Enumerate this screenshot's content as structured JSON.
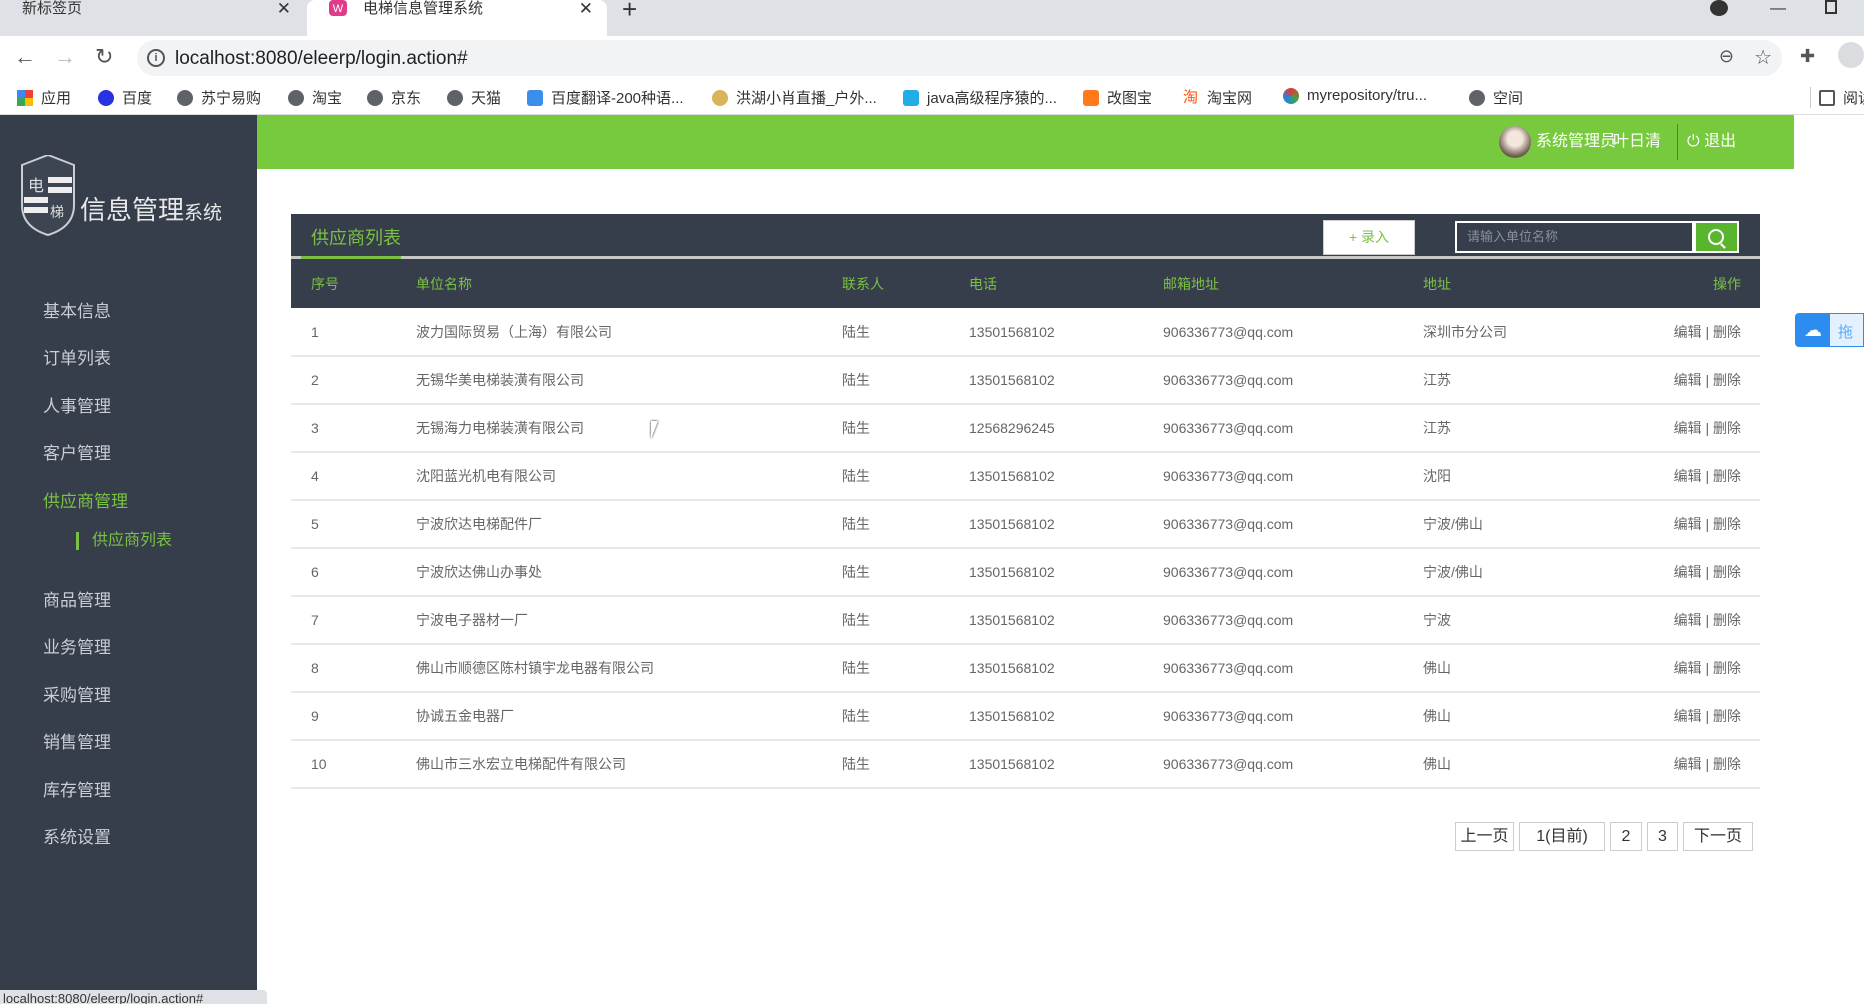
{
  "browser": {
    "tabs": [
      {
        "title": "新标签页"
      },
      {
        "title": "电梯信息管理系统"
      }
    ],
    "url": "localhost:8080/eleerp/login.action#",
    "status_url": "localhost:8080/eleerp/login.action#",
    "bookmarks": [
      "应用",
      "百度",
      "苏宁易购",
      "淘宝",
      "京东",
      "天猫",
      "百度翻译-200种语...",
      "洪湖小肖直播_户外...",
      "java高级程序猿的...",
      "改图宝",
      "淘宝网",
      "myrepository/tru...",
      "空间",
      "阅读"
    ]
  },
  "logo": {
    "text": "信息管理系统",
    "badge": "电梯"
  },
  "sidebar": {
    "items": [
      "基本信息",
      "订单列表",
      "人事管理",
      "客户管理",
      "供应商管理",
      "商品管理",
      "业务管理",
      "采购管理",
      "销售管理",
      "库存管理",
      "系统设置"
    ],
    "active": "供应商管理",
    "subitem": "供应商列表"
  },
  "topbar": {
    "role": "系统管理员",
    "user": "叶日清",
    "logout": "退出"
  },
  "panel": {
    "title": "供应商列表",
    "add_label": "+ 录入",
    "search_placeholder": "请输入单位名称"
  },
  "table": {
    "columns": [
      "序号",
      "单位名称",
      "联系人",
      "电话",
      "邮箱地址",
      "地址",
      "操作"
    ],
    "rows": [
      [
        "1",
        "波力国际贸易（上海）有限公司",
        "陆生",
        "13501568102",
        "906336773@qq.com",
        "深圳市分公司"
      ],
      [
        "2",
        "无锡华美电梯装潢有限公司",
        "陆生",
        "13501568102",
        "906336773@qq.com",
        "江苏"
      ],
      [
        "3",
        "无锡海力电梯装潢有限公司",
        "陆生",
        "12568296245",
        "906336773@qq.com",
        "江苏"
      ],
      [
        "4",
        "沈阳蓝光机电有限公司",
        "陆生",
        "13501568102",
        "906336773@qq.com",
        "沈阳"
      ],
      [
        "5",
        "宁波欣达电梯配件厂",
        "陆生",
        "13501568102",
        "906336773@qq.com",
        "宁波/佛山"
      ],
      [
        "6",
        "宁波欣达佛山办事处",
        "陆生",
        "13501568102",
        "906336773@qq.com",
        "宁波/佛山"
      ],
      [
        "7",
        "宁波电子器材一厂",
        "陆生",
        "13501568102",
        "906336773@qq.com",
        "宁波"
      ],
      [
        "8",
        "佛山市顺德区陈村镇宇龙电器有限公司",
        "陆生",
        "13501568102",
        "906336773@qq.com",
        "佛山"
      ],
      [
        "9",
        "协诚五金电器厂",
        "陆生",
        "13501568102",
        "906336773@qq.com",
        "佛山"
      ],
      [
        "10",
        "佛山市三水宏立电梯配件有限公司",
        "陆生",
        "13501568102",
        "906336773@qq.com",
        "佛山"
      ]
    ],
    "edit": "编辑",
    "sep": "|",
    "delete": "删除"
  },
  "pager": {
    "prev": "上一页",
    "current": "1(目前)",
    "pages": [
      "2",
      "3"
    ],
    "next": "下一页"
  },
  "float_widget": {
    "label": "拖"
  }
}
